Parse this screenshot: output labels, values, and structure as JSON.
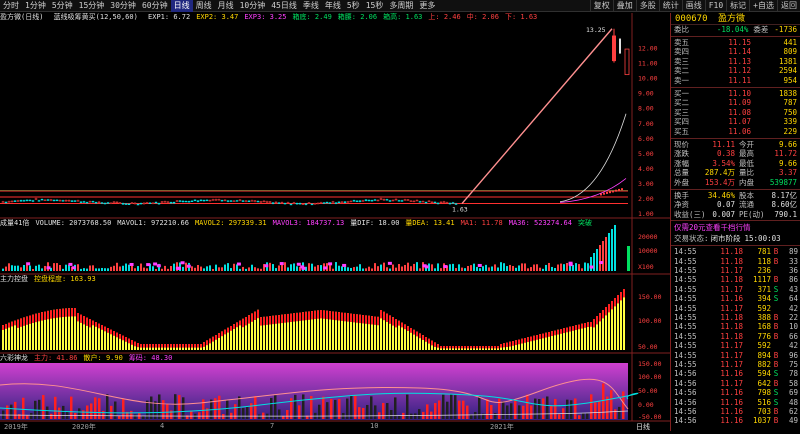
{
  "toolbar": {
    "periods": [
      "分时",
      "1分钟",
      "5分钟",
      "15分钟",
      "30分钟",
      "60分钟",
      "日线",
      "周线",
      "月线",
      "10分钟",
      "45日线",
      "季线",
      "年线",
      "5秒",
      "15秒",
      "多周期",
      "更多"
    ],
    "active": "日线",
    "buttons": [
      "复权",
      "叠加",
      "多股",
      "统计",
      "画线",
      "F10",
      "标记",
      "+自选",
      "返回"
    ]
  },
  "pane1": {
    "name": "盈方微(日线)",
    "indicator": "蓝线吸筹黄买(12,50,60)",
    "items": [
      {
        "t": "EXP1: 6.72",
        "c": "#e0e0e0"
      },
      {
        "t": "EXP2: 3.47",
        "c": "#ffd700"
      },
      {
        "t": "EXP3: 3.25",
        "c": "#ff40ff"
      },
      {
        "t": "箱底: 2.49",
        "c": "#00e060"
      },
      {
        "t": "箱腰: 2.06",
        "c": "#00e060"
      },
      {
        "t": "箱高: 1.63",
        "c": "#00e060"
      },
      {
        "t": "上: 2.46",
        "c": "#ff4040"
      },
      {
        "t": "中: 2.06",
        "c": "#ff4040"
      },
      {
        "t": "下: 1.63",
        "c": "#ff4040"
      }
    ],
    "peak_label": "13.25",
    "low_label": "1.63",
    "axis": [
      "12.00",
      "11.00",
      "10.00",
      "9.00",
      "8.00",
      "7.00",
      "6.00",
      "5.00",
      "4.00",
      "3.00",
      "2.00",
      "1.00"
    ]
  },
  "pane2": {
    "items": [
      {
        "t": "成量41倍",
        "c": "#e0e0e0"
      },
      {
        "t": "VOLUME: 2073768.50",
        "c": "#e0e0e0"
      },
      {
        "t": "MAVOL1: 972210.66",
        "c": "#e0e0e0"
      },
      {
        "t": "MAVOL2: 297339.31",
        "c": "#ffd700"
      },
      {
        "t": "MAVOL3: 184737.13",
        "c": "#ff40ff"
      },
      {
        "t": "量DIF: 18.00",
        "c": "#e0e0e0"
      },
      {
        "t": "量DEA: 13.41",
        "c": "#ffd700"
      },
      {
        "t": "MA1: 11.78",
        "c": "#ff4040"
      },
      {
        "t": "MA36: 523274.64",
        "c": "#ff40ff"
      },
      {
        "t": "突破",
        "c": "#00e060"
      }
    ],
    "axis": [
      "20000",
      "10000",
      "X100"
    ]
  },
  "pane3": {
    "items": [
      {
        "t": "主力控盘",
        "c": "#e0e0e0"
      },
      {
        "t": "控盘程度: 163.93",
        "c": "#ffd700"
      }
    ],
    "axis": [
      "150.00",
      "100.00",
      "50.00"
    ]
  },
  "pane4": {
    "items": [
      {
        "t": "六彩神龙",
        "c": "#e0e0e0"
      },
      {
        "t": "主力: 41.86",
        "c": "#ff4040"
      },
      {
        "t": "散户: 9.90",
        "c": "#ffd700"
      },
      {
        "t": "筹码: 48.30",
        "c": "#ff40ff"
      }
    ],
    "axis": [
      "150.00",
      "100.00",
      "50.00",
      "0.00",
      "-50.00"
    ],
    "datebar": [
      "2019年",
      "2020年",
      "4",
      "7",
      "10",
      "2021年"
    ],
    "datebar_right": "日线"
  },
  "panel": {
    "code": "000670",
    "name": "盈方微",
    "weibi_label": "委比",
    "weibi": "-18.04%",
    "weicha_label": "委差",
    "weicha": "-1736",
    "sells": [
      {
        "l": "卖五",
        "p": "11.15",
        "v": "441"
      },
      {
        "l": "卖四",
        "p": "11.14",
        "v": "809"
      },
      {
        "l": "卖三",
        "p": "11.13",
        "v": "1381"
      },
      {
        "l": "卖二",
        "p": "11.12",
        "v": "2594"
      },
      {
        "l": "卖一",
        "p": "11.11",
        "v": "954"
      }
    ],
    "buys": [
      {
        "l": "买一",
        "p": "11.10",
        "v": "1838"
      },
      {
        "l": "买二",
        "p": "11.09",
        "v": "787"
      },
      {
        "l": "买三",
        "p": "11.08",
        "v": "750"
      },
      {
        "l": "买四",
        "p": "11.07",
        "v": "339"
      },
      {
        "l": "买五",
        "p": "11.06",
        "v": "229"
      }
    ],
    "stats": [
      {
        "a": "现价",
        "av": "11.11",
        "ac": "red",
        "b": "今开",
        "bv": "9.66",
        "bc": "yel"
      },
      {
        "a": "涨跌",
        "av": "0.38",
        "ac": "red",
        "b": "最高",
        "bv": "11.72",
        "bc": "red"
      },
      {
        "a": "涨幅",
        "av": "3.54%",
        "ac": "red",
        "b": "最低",
        "bv": "9.66",
        "bc": "yel"
      },
      {
        "a": "总量",
        "av": "287.4万",
        "ac": "yel",
        "b": "量比",
        "bv": "3.37",
        "bc": "red"
      },
      {
        "a": "外盘",
        "av": "153.4万",
        "ac": "red",
        "b": "内盘",
        "bv": "539877",
        "bc": "green"
      }
    ],
    "stats2": [
      {
        "a": "换手",
        "av": "34.46%",
        "ac": "yel",
        "b": "股本",
        "bv": "8.17亿",
        "bc": "wht"
      },
      {
        "a": "净资",
        "av": "0.07",
        "ac": "wht",
        "b": "流通",
        "bv": "8.60亿",
        "bc": "wht"
      },
      {
        "a": "收益(三)",
        "av": "0.007",
        "ac": "wht",
        "b": "PE(动)",
        "bv": "790.1",
        "bc": "wht"
      }
    ],
    "ad": "仅需20元查看千档行情",
    "status_label": "交易状态:",
    "status": "闭市阶段",
    "status_time": "15:00:03",
    "ticks": [
      {
        "t": "14:55",
        "p": "11.18",
        "v": "781",
        "d": "B",
        "n": "89"
      },
      {
        "t": "14:55",
        "p": "11.18",
        "v": "118",
        "d": "B",
        "n": "33"
      },
      {
        "t": "14:55",
        "p": "11.17",
        "v": "236",
        "d": "",
        "n": "36"
      },
      {
        "t": "14:55",
        "p": "11.18",
        "v": "1117",
        "d": "B",
        "n": "86"
      },
      {
        "t": "14:55",
        "p": "11.17",
        "v": "371",
        "d": "S",
        "n": "43"
      },
      {
        "t": "14:55",
        "p": "11.16",
        "v": "394",
        "d": "S",
        "n": "64"
      },
      {
        "t": "14:55",
        "p": "11.17",
        "v": "592",
        "d": "",
        "n": "42"
      },
      {
        "t": "14:55",
        "p": "11.18",
        "v": "388",
        "d": "B",
        "n": "22"
      },
      {
        "t": "14:55",
        "p": "11.18",
        "v": "168",
        "d": "B",
        "n": "10"
      },
      {
        "t": "14:55",
        "p": "11.18",
        "v": "776",
        "d": "B",
        "n": "66"
      },
      {
        "t": "14:55",
        "p": "11.17",
        "v": "592",
        "d": "",
        "n": "42"
      },
      {
        "t": "14:55",
        "p": "11.17",
        "v": "894",
        "d": "B",
        "n": "96"
      },
      {
        "t": "14:55",
        "p": "11.17",
        "v": "882",
        "d": "B",
        "n": "75"
      },
      {
        "t": "14:56",
        "p": "11.16",
        "v": "594",
        "d": "S",
        "n": "78"
      },
      {
        "t": "14:56",
        "p": "11.17",
        "v": "642",
        "d": "B",
        "n": "58"
      },
      {
        "t": "14:56",
        "p": "11.16",
        "v": "798",
        "d": "S",
        "n": "69"
      },
      {
        "t": "14:56",
        "p": "11.16",
        "v": "516",
        "d": "S",
        "n": "48"
      },
      {
        "t": "14:56",
        "p": "11.16",
        "v": "703",
        "d": "B",
        "n": "62"
      },
      {
        "t": "14:56",
        "p": "11.16",
        "v": "1037",
        "d": "B",
        "n": "49"
      }
    ]
  },
  "chart_data": {
    "type": "line",
    "title": "",
    "xlabel": "",
    "ylabel": "",
    "ylim": [
      1.0,
      13.5
    ],
    "x": [
      "2019年",
      "2020年",
      "4",
      "7",
      "10",
      "2021年"
    ],
    "series": [
      {
        "values": [
          1.8,
          1.7,
          1.65,
          1.7,
          1.63,
          1.9,
          13.25,
          11.11
        ]
      }
    ]
  },
  "colors": {
    "up": "#ff4040",
    "down": "#00e060",
    "ma1": "#ffd700",
    "ma2": "#ff40ff",
    "accent": "#202880"
  }
}
